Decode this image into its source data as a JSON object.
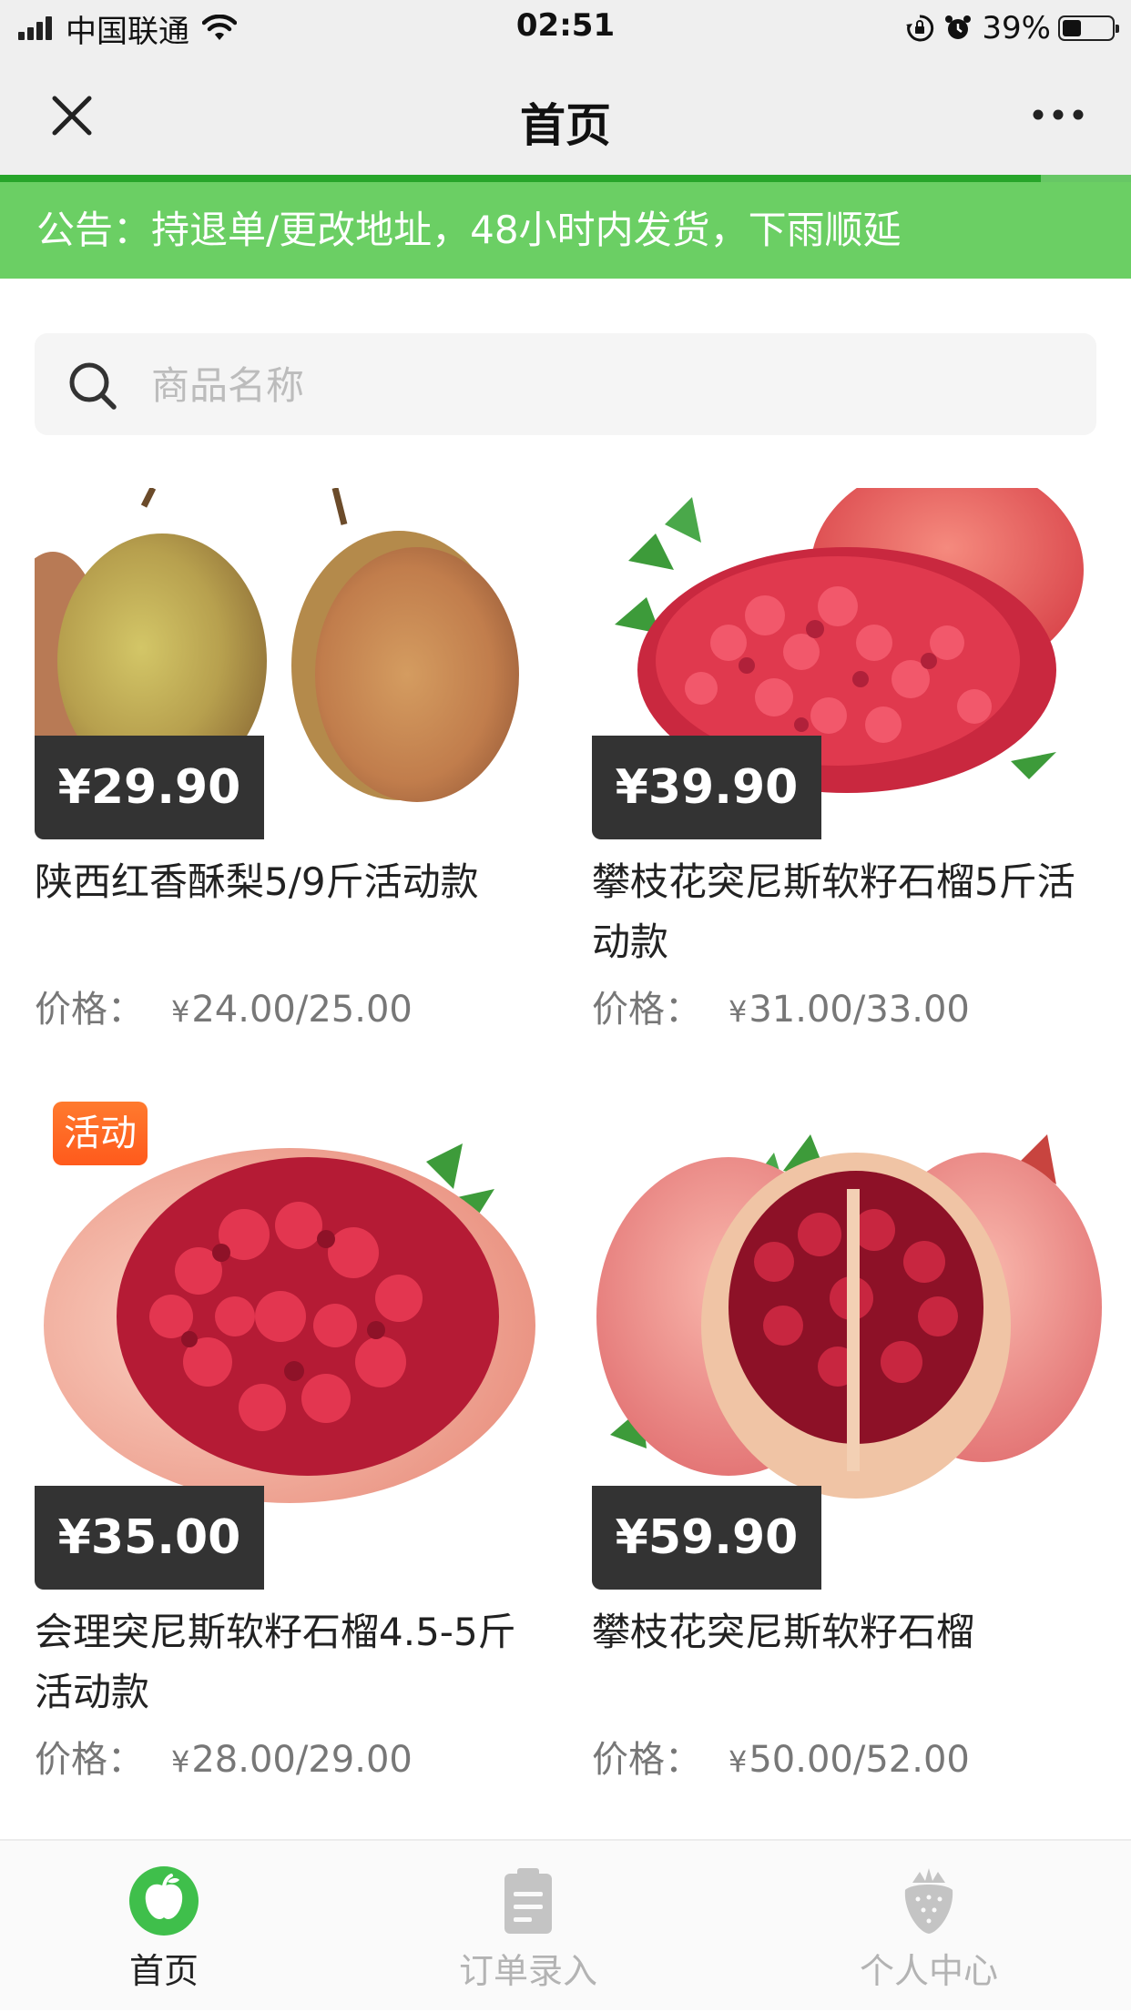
{
  "status_bar": {
    "carrier": "中国联通",
    "time": "02:51",
    "battery_percent": "39%",
    "battery_level": 0.39,
    "icons": [
      "signal-icon",
      "wifi-icon",
      "orientation-lock-icon",
      "alarm-icon",
      "battery-icon"
    ]
  },
  "nav": {
    "title": "首页",
    "close_icon": "close-icon",
    "more_icon": "more-icon",
    "load_progress": 0.92
  },
  "notice": {
    "text": "公告：持退单/更改地址，48小时内发货，下雨顺延"
  },
  "search": {
    "placeholder": "商品名称",
    "value": ""
  },
  "products": [
    {
      "price_tag": "¥29.90",
      "name": "陕西红香酥梨5/9斤活动款",
      "price_label": "价格：",
      "price_yen": "¥",
      "price_value": "24.00/25.00",
      "badge": ""
    },
    {
      "price_tag": "¥39.90",
      "name": "攀枝花突尼斯软籽石榴5斤活动款",
      "price_label": "价格：",
      "price_yen": "¥",
      "price_value": "31.00/33.00",
      "badge": ""
    },
    {
      "price_tag": "¥35.00",
      "name": "会理突尼斯软籽石榴4.5-5斤活动款",
      "price_label": "价格：",
      "price_yen": "¥",
      "price_value": "28.00/29.00",
      "badge": "活动"
    },
    {
      "price_tag": "¥59.90",
      "name": "攀枝花突尼斯软籽石榴",
      "price_label": "价格：",
      "price_yen": "¥",
      "price_value": "50.00/52.00",
      "badge": ""
    }
  ],
  "tab_bar": {
    "tabs": [
      {
        "label": "首页",
        "icon": "apple-icon",
        "active": true
      },
      {
        "label": "订单录入",
        "icon": "clipboard-icon",
        "active": false
      },
      {
        "label": "个人中心",
        "icon": "strawberry-icon",
        "active": false
      }
    ],
    "colors": {
      "active": "#3fbf4b",
      "inactive": "#b3b3b3"
    }
  },
  "colors": {
    "brand_green": "#6bcf64",
    "price_tag_bg": "#333333",
    "badge_orange": "#ff6a24"
  }
}
